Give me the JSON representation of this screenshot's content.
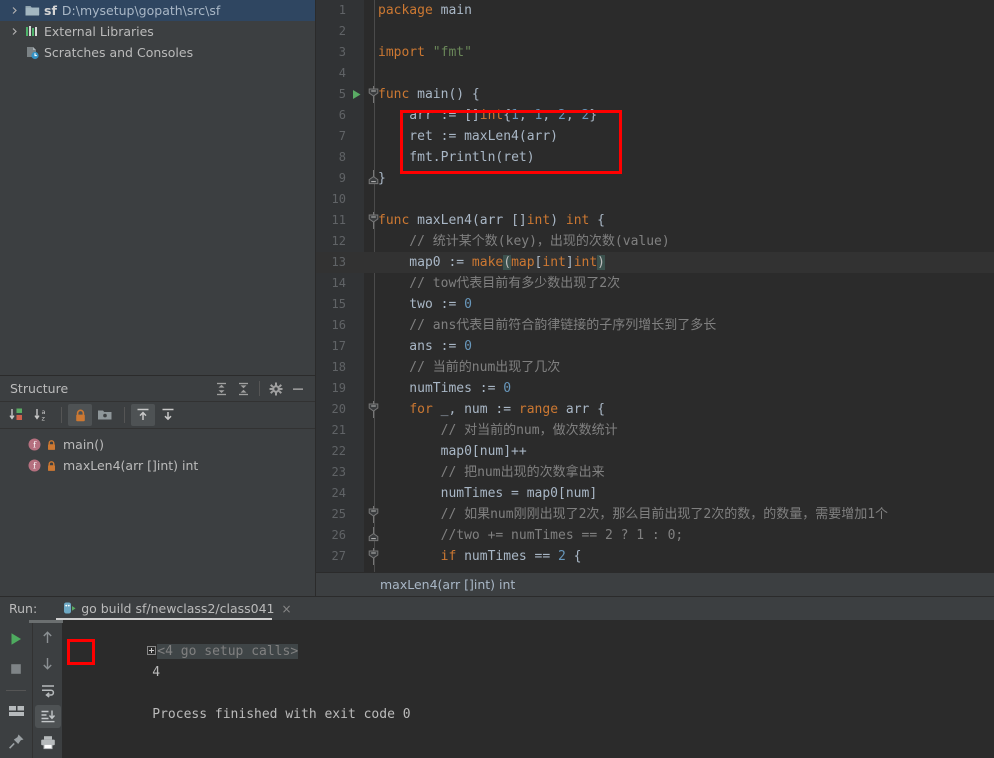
{
  "project": {
    "tree": [
      {
        "label_bold": "sf",
        "label": "D:\\mysetup\\gopath\\src\\sf",
        "icon": "folder-module-icon",
        "arrow": true,
        "selected": true,
        "indent": 0
      },
      {
        "label_bold": "",
        "label": "External Libraries",
        "icon": "libraries-icon",
        "arrow": true,
        "selected": false,
        "indent": 0
      },
      {
        "label_bold": "",
        "label": "Scratches and Consoles",
        "icon": "scratches-icon",
        "arrow": false,
        "selected": false,
        "indent": 0
      }
    ]
  },
  "structure": {
    "title": "Structure",
    "header_buttons": [
      {
        "name": "expand-all-icon"
      },
      {
        "name": "collapse-all-icon"
      },
      {
        "name": "gear-icon"
      },
      {
        "name": "hide-icon"
      }
    ],
    "toolbar_buttons": [
      {
        "name": "sort-by-visibility-icon",
        "active": false
      },
      {
        "name": "sort-alphabetically-icon",
        "active": false
      },
      {
        "name": "show-non-public-icon",
        "active": true
      },
      {
        "name": "group-icon",
        "active": false
      },
      {
        "name": "show-inherited-icon",
        "active": true
      },
      {
        "name": "show-imported-icon",
        "active": false
      }
    ],
    "items": [
      {
        "label": "main()",
        "kind": "f",
        "lock": true
      },
      {
        "label": "maxLen4(arr []int) int",
        "kind": "f",
        "lock": true
      }
    ]
  },
  "editor": {
    "breadcrumb": "maxLen4(arr []int) int",
    "current_line": 13,
    "run_marker_line": 5,
    "lines": [
      {
        "n": 1,
        "fold": "",
        "tokens": [
          {
            "t": "package ",
            "c": "kw"
          },
          {
            "t": "main",
            "c": "pkgn"
          }
        ]
      },
      {
        "n": 2,
        "fold": "",
        "tokens": []
      },
      {
        "n": 3,
        "fold": "",
        "tokens": [
          {
            "t": "import ",
            "c": "kw"
          },
          {
            "t": "\"fmt\"",
            "c": "str"
          }
        ]
      },
      {
        "n": 4,
        "fold": "",
        "tokens": []
      },
      {
        "n": 5,
        "fold": "open",
        "tokens": [
          {
            "t": "func ",
            "c": "kw"
          },
          {
            "t": "main",
            "c": "plain"
          },
          {
            "t": "() {",
            "c": "plain"
          }
        ]
      },
      {
        "n": 6,
        "fold": "",
        "tokens": [
          {
            "t": "    arr := []",
            "c": "plain"
          },
          {
            "t": "int",
            "c": "kw"
          },
          {
            "t": "{",
            "c": "plain"
          },
          {
            "t": "1",
            "c": "num"
          },
          {
            "t": ", ",
            "c": "plain"
          },
          {
            "t": "1",
            "c": "num"
          },
          {
            "t": ", ",
            "c": "plain"
          },
          {
            "t": "2",
            "c": "num"
          },
          {
            "t": ", ",
            "c": "plain"
          },
          {
            "t": "2",
            "c": "num"
          },
          {
            "t": "}",
            "c": "plain"
          }
        ]
      },
      {
        "n": 7,
        "fold": "",
        "tokens": [
          {
            "t": "    ret := maxLen4(arr)",
            "c": "plain"
          }
        ]
      },
      {
        "n": 8,
        "fold": "",
        "tokens": [
          {
            "t": "    fmt",
            "c": "plain"
          },
          {
            "t": ".",
            "c": "plain"
          },
          {
            "t": "Println",
            "c": "plain"
          },
          {
            "t": "(ret)",
            "c": "plain"
          }
        ]
      },
      {
        "n": 9,
        "fold": "close",
        "tokens": [
          {
            "t": "}",
            "c": "plain"
          }
        ]
      },
      {
        "n": 10,
        "fold": "",
        "tokens": []
      },
      {
        "n": 11,
        "fold": "open",
        "tokens": [
          {
            "t": "func ",
            "c": "kw"
          },
          {
            "t": "maxLen4",
            "c": "plain"
          },
          {
            "t": "(arr []",
            "c": "plain"
          },
          {
            "t": "int",
            "c": "kw"
          },
          {
            "t": ") ",
            "c": "plain"
          },
          {
            "t": "int",
            "c": "kw"
          },
          {
            "t": " {",
            "c": "plain"
          }
        ]
      },
      {
        "n": 12,
        "fold": "",
        "tokens": [
          {
            "t": "    // 统计某个数(key)，出现的次数(value)",
            "c": "cmt"
          }
        ]
      },
      {
        "n": 13,
        "fold": "",
        "tokens": [
          {
            "t": "    map0 := ",
            "c": "plain"
          },
          {
            "t": "make",
            "c": "kw"
          },
          {
            "t": "(",
            "c": "brmatch"
          },
          {
            "t": "map",
            "c": "kw"
          },
          {
            "t": "[",
            "c": "plain"
          },
          {
            "t": "int",
            "c": "kw"
          },
          {
            "t": "]",
            "c": "plain"
          },
          {
            "t": "int",
            "c": "kw"
          },
          {
            "t": ")",
            "c": "brmatch"
          }
        ]
      },
      {
        "n": 14,
        "fold": "",
        "tokens": [
          {
            "t": "    // tow代表目前有多少数出现了2次",
            "c": "cmt"
          }
        ]
      },
      {
        "n": 15,
        "fold": "",
        "tokens": [
          {
            "t": "    two := ",
            "c": "plain"
          },
          {
            "t": "0",
            "c": "num"
          }
        ]
      },
      {
        "n": 16,
        "fold": "",
        "tokens": [
          {
            "t": "    // ans代表目前符合韵律链接的子序列增长到了多长",
            "c": "cmt"
          }
        ]
      },
      {
        "n": 17,
        "fold": "",
        "tokens": [
          {
            "t": "    ans := ",
            "c": "plain"
          },
          {
            "t": "0",
            "c": "num"
          }
        ]
      },
      {
        "n": 18,
        "fold": "",
        "tokens": [
          {
            "t": "    // 当前的num出现了几次",
            "c": "cmt"
          }
        ]
      },
      {
        "n": 19,
        "fold": "",
        "tokens": [
          {
            "t": "    numTimes := ",
            "c": "plain"
          },
          {
            "t": "0",
            "c": "num"
          }
        ]
      },
      {
        "n": 20,
        "fold": "open",
        "tokens": [
          {
            "t": "    ",
            "c": "plain"
          },
          {
            "t": "for ",
            "c": "kw"
          },
          {
            "t": "_, num := ",
            "c": "plain"
          },
          {
            "t": "range ",
            "c": "kw"
          },
          {
            "t": "arr {",
            "c": "plain"
          }
        ]
      },
      {
        "n": 21,
        "fold": "",
        "tokens": [
          {
            "t": "        // 对当前的num，做次数统计",
            "c": "cmt"
          }
        ]
      },
      {
        "n": 22,
        "fold": "",
        "tokens": [
          {
            "t": "        map0[num]++",
            "c": "plain"
          }
        ]
      },
      {
        "n": 23,
        "fold": "",
        "tokens": [
          {
            "t": "        // 把num出现的次数拿出来",
            "c": "cmt"
          }
        ]
      },
      {
        "n": 24,
        "fold": "",
        "tokens": [
          {
            "t": "        numTimes = map0[num]",
            "c": "plain"
          }
        ]
      },
      {
        "n": 25,
        "fold": "open",
        "tokens": [
          {
            "t": "        // 如果num刚刚出现了2次，那么目前出现了2次的数，的数量，需要增加1个",
            "c": "cmt"
          }
        ]
      },
      {
        "n": 26,
        "fold": "close",
        "tokens": [
          {
            "t": "        //two += numTimes == 2 ? 1 : 0;",
            "c": "cmt"
          }
        ]
      },
      {
        "n": 27,
        "fold": "open",
        "tokens": [
          {
            "t": "        ",
            "c": "plain"
          },
          {
            "t": "if ",
            "c": "kw"
          },
          {
            "t": "numTimes == ",
            "c": "plain"
          },
          {
            "t": "2",
            "c": "num"
          },
          {
            "t": " {",
            "c": "plain"
          }
        ]
      }
    ]
  },
  "run_panel": {
    "label": "Run:",
    "tab": {
      "title": "go build sf/newclass2/class041",
      "icon": "go-run-config-icon",
      "close": "×"
    },
    "sidebar_left": [
      {
        "name": "rerun-button",
        "icon": "play-icon",
        "active": false
      },
      {
        "name": "stop-button",
        "icon": "stop-icon",
        "active": false
      },
      {
        "name": "layout-button",
        "icon": "layout-icon",
        "active": false
      },
      {
        "name": "pin-tab-button",
        "icon": "pin-icon",
        "active": false
      }
    ],
    "sidebar_right": [
      {
        "name": "up-stacktrace-button",
        "icon": "arrow-up-icon",
        "active": false
      },
      {
        "name": "down-stacktrace-button",
        "icon": "arrow-down-icon",
        "active": false
      },
      {
        "name": "soft-wrap-button",
        "icon": "soft-wrap-icon",
        "active": false
      },
      {
        "name": "scroll-to-end-button",
        "icon": "scroll-end-icon",
        "active": true
      },
      {
        "name": "print-button",
        "icon": "printer-icon",
        "active": false
      }
    ],
    "console": {
      "folded_line": "<4 go setup calls>",
      "output_value": "4",
      "exit_line": "Process finished with exit code 0"
    }
  },
  "annotations": [
    {
      "name": "code-highlight-box",
      "color": "#ff0000"
    },
    {
      "name": "output-highlight-box",
      "color": "#ff0000"
    }
  ]
}
